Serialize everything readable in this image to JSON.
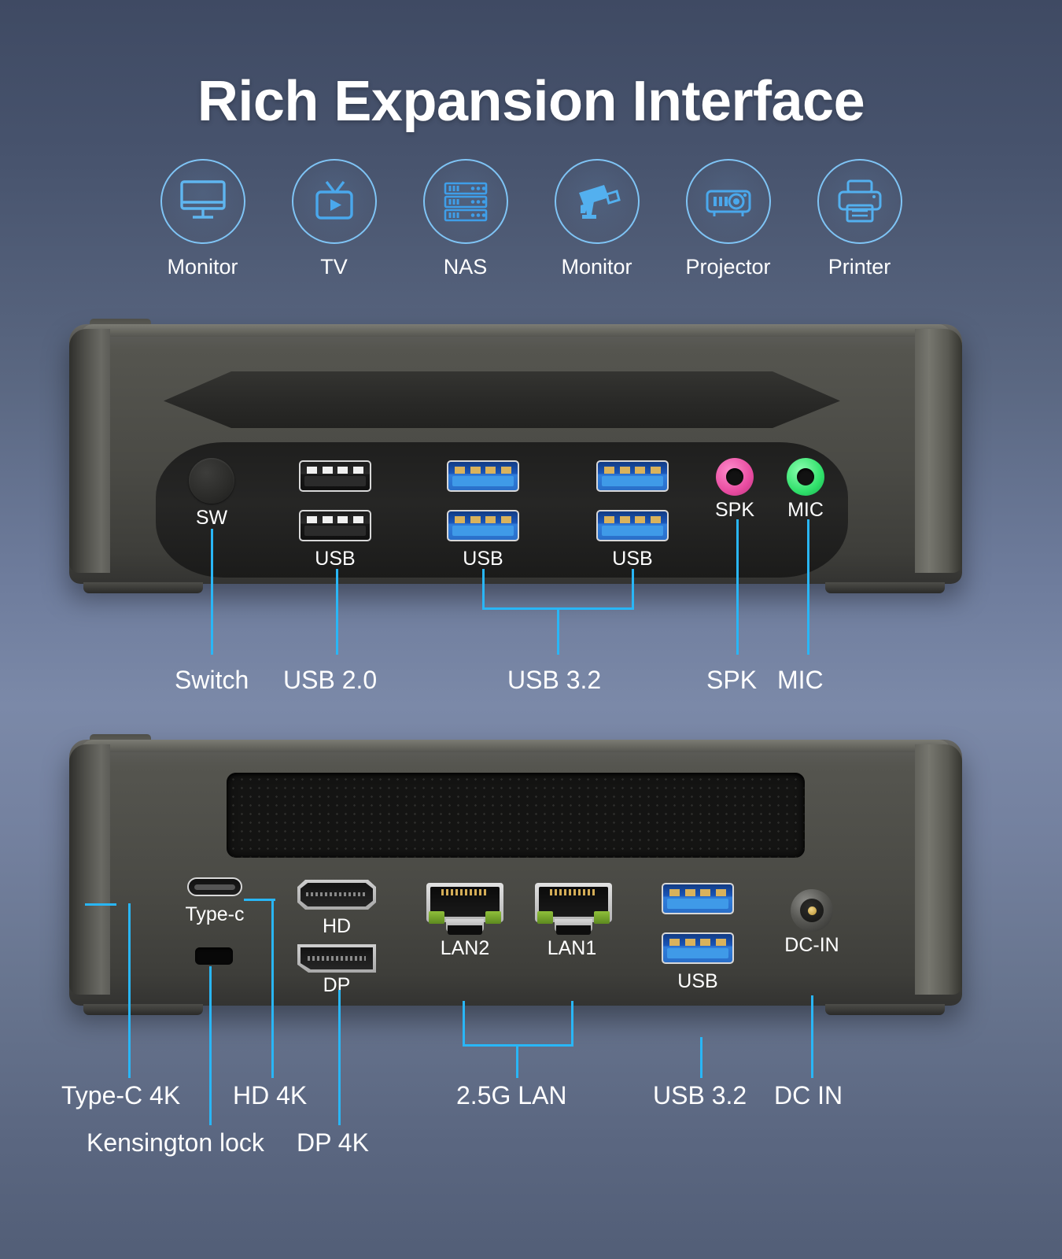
{
  "title": "Rich Expansion Interface",
  "accent_color": "#29b6f6",
  "devices": [
    {
      "name": "monitor-icon",
      "label": "Monitor"
    },
    {
      "name": "tv-icon",
      "label": "TV"
    },
    {
      "name": "nas-icon",
      "label": "NAS"
    },
    {
      "name": "security-camera-icon",
      "label": "Monitor"
    },
    {
      "name": "projector-icon",
      "label": "Projector"
    },
    {
      "name": "printer-icon",
      "label": "Printer"
    }
  ],
  "front_panel": {
    "port_labels": {
      "switch": "SW",
      "usb_left": "USB",
      "usb_mid": "USB",
      "usb_right": "USB",
      "spk": "SPK",
      "mic": "MIC"
    },
    "jack_colors": {
      "spk": "#e84ba0",
      "mic": "#2fe06a"
    },
    "callouts": [
      {
        "name": "callout-switch",
        "label": "Switch"
      },
      {
        "name": "callout-usb20",
        "label": "USB 2.0"
      },
      {
        "name": "callout-usb32",
        "label": "USB 3.2"
      },
      {
        "name": "callout-spk",
        "label": "SPK"
      },
      {
        "name": "callout-mic",
        "label": "MIC"
      }
    ]
  },
  "rear_panel": {
    "port_labels": {
      "typec": "Type-c",
      "hd": "HD",
      "dp": "DP",
      "lan2": "LAN2",
      "lan1": "LAN1",
      "usb": "USB",
      "dcin": "DC-IN"
    },
    "callouts": [
      {
        "name": "callout-typec-4k",
        "label": "Type-C 4K"
      },
      {
        "name": "callout-kensington-lock",
        "label": "Kensington lock"
      },
      {
        "name": "callout-hd-4k",
        "label": "HD 4K"
      },
      {
        "name": "callout-dp-4k",
        "label": "DP 4K"
      },
      {
        "name": "callout-25g-lan",
        "label": "2.5G LAN"
      },
      {
        "name": "callout-usb32-rear",
        "label": "USB 3.2"
      },
      {
        "name": "callout-dc-in",
        "label": "DC IN"
      }
    ]
  }
}
